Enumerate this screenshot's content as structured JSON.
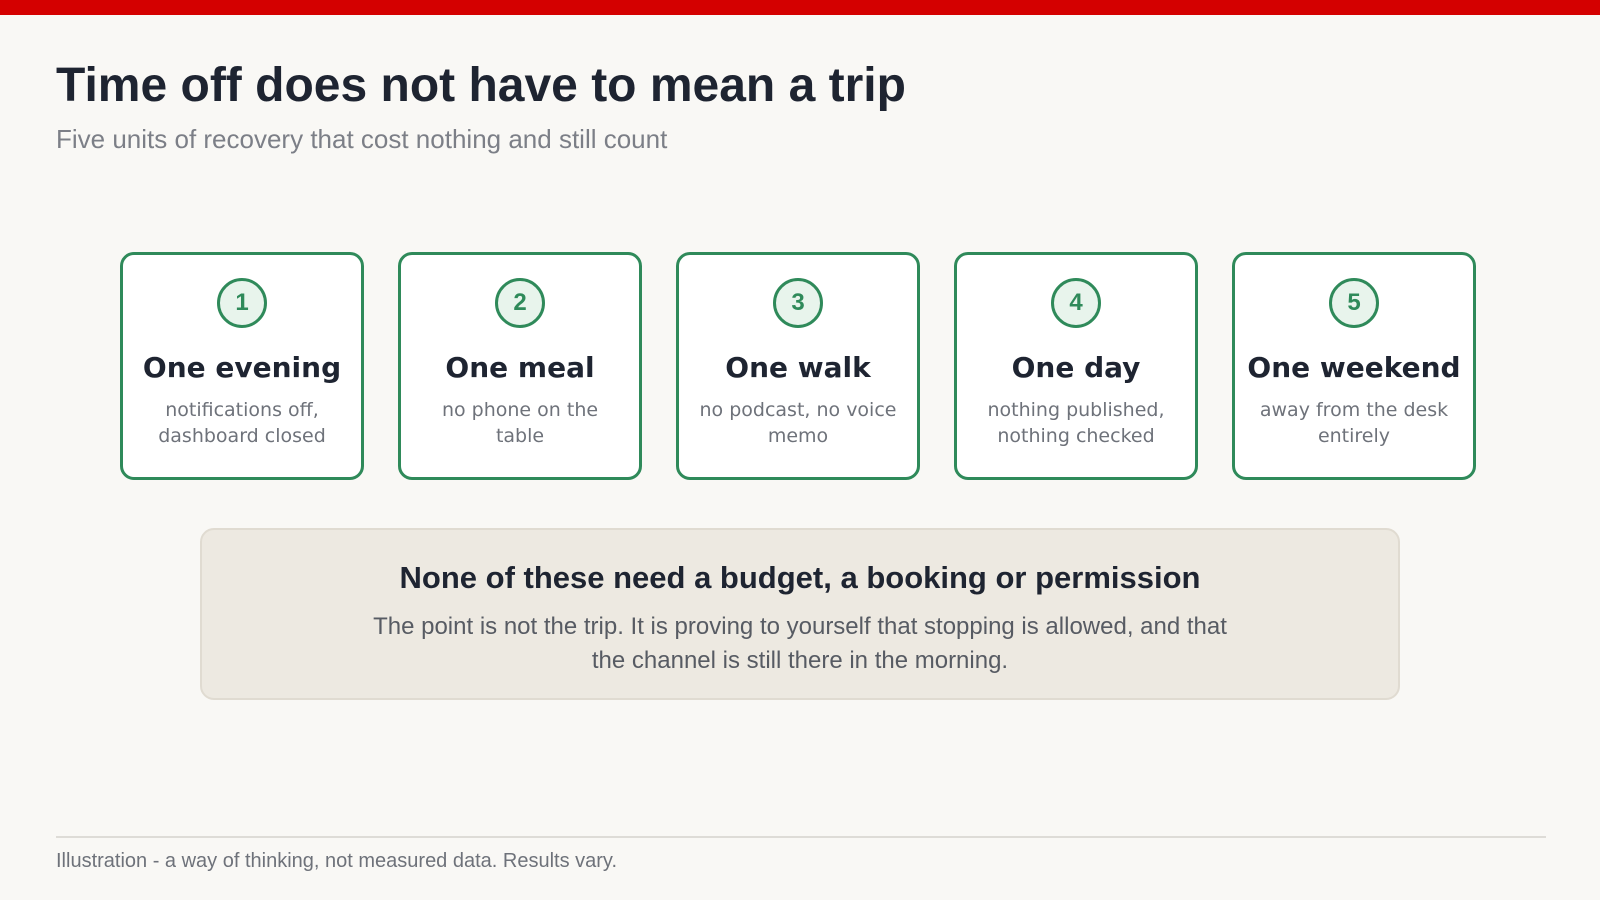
{
  "colors": {
    "top_bar": "#d40000",
    "accent": "#2f8a5a",
    "background": "#f9f8f5",
    "note_background": "#ede9e1"
  },
  "header": {
    "title": "Time off does not have to mean a trip",
    "subtitle": "Five units of recovery that cost nothing and still count"
  },
  "cards": [
    {
      "number": "1",
      "title": "One evening",
      "desc": "notifications off, dashboard closed"
    },
    {
      "number": "2",
      "title": "One meal",
      "desc": "no phone on the table"
    },
    {
      "number": "3",
      "title": "One walk",
      "desc": "no podcast, no voice memo"
    },
    {
      "number": "4",
      "title": "One day",
      "desc": "nothing published, nothing checked"
    },
    {
      "number": "5",
      "title": "One weekend",
      "desc": "away from the desk entirely"
    }
  ],
  "note": {
    "title": "None of these need a budget, a booking or permission",
    "body": "The point is not the trip. It is proving to yourself that stopping is allowed, and that the channel is still there in the morning."
  },
  "footer": {
    "text": "Illustration - a way of thinking, not measured data. Results vary."
  }
}
